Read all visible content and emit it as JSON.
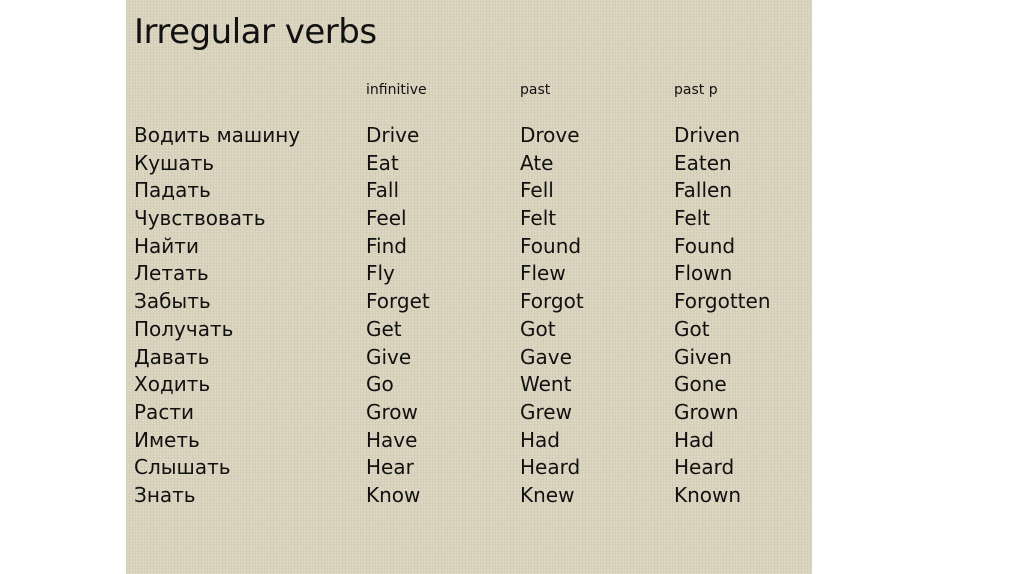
{
  "slide": {
    "title": "Irregular verbs",
    "background_color": "#d9d3bd",
    "headers": {
      "translation": "",
      "infinitive": "infinitive",
      "past": "past",
      "past_participle": "past p"
    },
    "rows": [
      {
        "ru": "Водить машину",
        "infinitive": "Drive",
        "past": "Drove",
        "past_p": "Driven"
      },
      {
        "ru": "Кушать",
        "infinitive": "Eat",
        "past": "Ate",
        "past_p": "Eaten"
      },
      {
        "ru": "Падать",
        "infinitive": "Fall",
        "past": "Fell",
        "past_p": "Fallen"
      },
      {
        "ru": "Чувствовать",
        "infinitive": "Feel",
        "past": "Felt",
        "past_p": "Felt"
      },
      {
        "ru": "Найти",
        "infinitive": "Find",
        "past": "Found",
        "past_p": "Found"
      },
      {
        "ru": "Летать",
        "infinitive": "Fly",
        "past": "Flew",
        "past_p": "Flown"
      },
      {
        "ru": "Забыть",
        "infinitive": "Forget",
        "past": "Forgot",
        "past_p": "Forgotten"
      },
      {
        "ru": "Получать",
        "infinitive": "Get",
        "past": "Got",
        "past_p": "Got"
      },
      {
        "ru": "Давать",
        "infinitive": "Give",
        "past": "Gave",
        "past_p": "Given"
      },
      {
        "ru": "Ходить",
        "infinitive": "Go",
        "past": "Went",
        "past_p": "Gone"
      },
      {
        "ru": "Расти",
        "infinitive": "Grow",
        "past": "Grew",
        "past_p": "Grown"
      },
      {
        "ru": "Иметь",
        "infinitive": "Have",
        "past": "Had",
        "past_p": "Had"
      },
      {
        "ru": "Слышать",
        "infinitive": "Hear",
        "past": "Heard",
        "past_p": "Heard"
      },
      {
        "ru": "Знать",
        "infinitive": "Know",
        "past": "Knew",
        "past_p": "Known"
      }
    ]
  }
}
